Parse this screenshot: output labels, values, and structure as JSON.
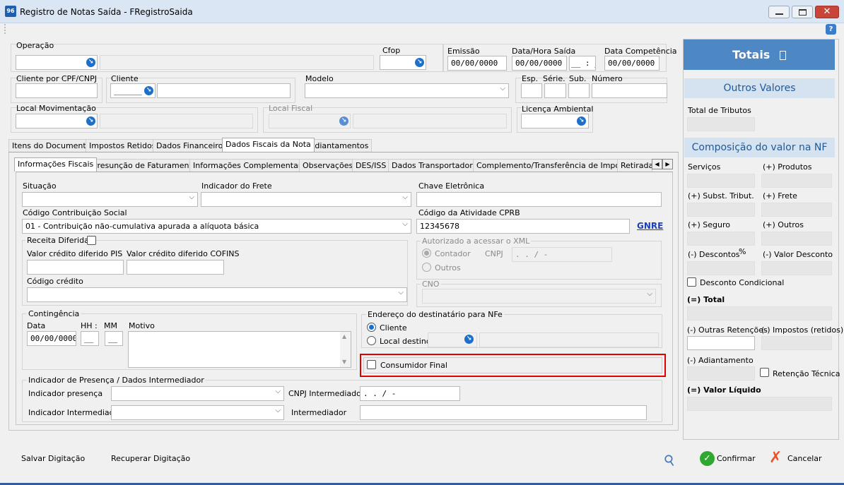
{
  "window": {
    "title": "Registro de Notas Saída - FRegistroSaida",
    "app_icon": "96"
  },
  "header": {
    "operacao": "Operação",
    "cfop": "Cfop",
    "emissao": "Emissão",
    "emissao_value": "00/00/0000",
    "data_hora_saida": "Data/Hora Saída",
    "data_hora_value": "00/00/0000",
    "hora_value": "__ : __",
    "data_competencia": "Data Competência",
    "data_competencia_value": "00/00/0000",
    "cliente_cpf": "Cliente por CPF/CNPJ",
    "cliente": "Cliente",
    "cliente_code": "______",
    "modelo": "Modelo",
    "esp": "Esp.",
    "serie": "Série.",
    "sub": "Sub.",
    "numero": "Número",
    "local_movimentacao": "Local Movimentação",
    "local_fiscal": "Local Fiscal",
    "licenca_ambiental": "Licença Ambiental"
  },
  "tabs_main": [
    "Itens do Documento",
    "Impostos Retidos",
    "Dados Financeiros",
    "Dados Fiscais da Nota",
    "Adiantamentos"
  ],
  "tabs_sub": [
    "Informações Fiscais",
    "Presunção de Faturamento",
    "Informações Complementares",
    "Observações",
    "DES/ISS",
    "Dados Transportadora",
    "Complemento/Transferência de Imposto",
    "Retirada,"
  ],
  "fiscal": {
    "situacao": "Situação",
    "indicador_frete": "Indicador do Frete",
    "chave_eletronica": "Chave Eletrônica",
    "codigo_contribuicao": "Código Contribuição Social",
    "codigo_contribuicao_value": "01 - Contribuição não-cumulativa apurada a alíquota básica",
    "codigo_atividade": "Código da Atividade CPRB",
    "codigo_atividade_value": "12345678",
    "gnre": "GNRE",
    "receita_diferida": "Receita Diferida",
    "valor_pis": "Valor crédito diferido PIS",
    "valor_cofins": "Valor crédito diferido COFINS",
    "codigo_credito": "Código crédito",
    "autorizado": "Autorizado a acessar o XML",
    "contador": "Contador",
    "cnpj": "CNPJ",
    "cnpj_mask": ". . / -",
    "outros": "Outros",
    "cno": "CNO",
    "contingencia": "Contingência",
    "data": "Data",
    "data_value": "00/00/0000",
    "hh": "HH :",
    "mm": "MM",
    "hh_value": "__",
    "mm_value": "__",
    "motivo": "Motivo",
    "endereco": "Endereço do destinatário para NFe",
    "cliente_radio": "Cliente",
    "local_destino": "Local destino",
    "consumidor_final": "Consumidor Final",
    "presenca_group": "Indicador de Presença / Dados Intermediador",
    "indicador_presenca": "Indicador presença",
    "cnpj_intermediador": "CNPJ Intermediador",
    "cnpj_intermediador_mask": ". . / -",
    "indicador_intermediador": "Indicador Intermediador",
    "intermediador": "Intermediador"
  },
  "totais": {
    "title": "Totais",
    "outros_valores": "Outros Valores",
    "total_tributos": "Total de Tributos",
    "composicao": "Composição do valor na NF",
    "servicos": "Serviços",
    "produtos": "(+) Produtos",
    "subst": "(+) Subst. Tribut.",
    "frete": "(+) Frete",
    "seguro": "(+) Seguro",
    "outros": "(+) Outros",
    "descontos": "(-) Descontos",
    "percent": "%",
    "valor_desconto": "(-) Valor Desconto",
    "desconto_condicional": "Desconto Condicional",
    "total": "(=) Total",
    "outras_retencoes": "(-) Outras Retenções",
    "impostos_retidos": "(-) Impostos (retidos)",
    "adiantamento": "(-) Adiantamento",
    "retencao_tecnica": "Retenção Técnica",
    "valor_liquido": "(=) Valor Líquido"
  },
  "footer": {
    "salvar": "Salvar Digitação",
    "recuperar": "Recuperar Digitação",
    "confirmar": "Confirmar",
    "cancelar": "Cancelar"
  },
  "colors": {
    "accent": "#1d6fc9",
    "totais_header": "#4d88c4",
    "highlight": "#e00000"
  }
}
